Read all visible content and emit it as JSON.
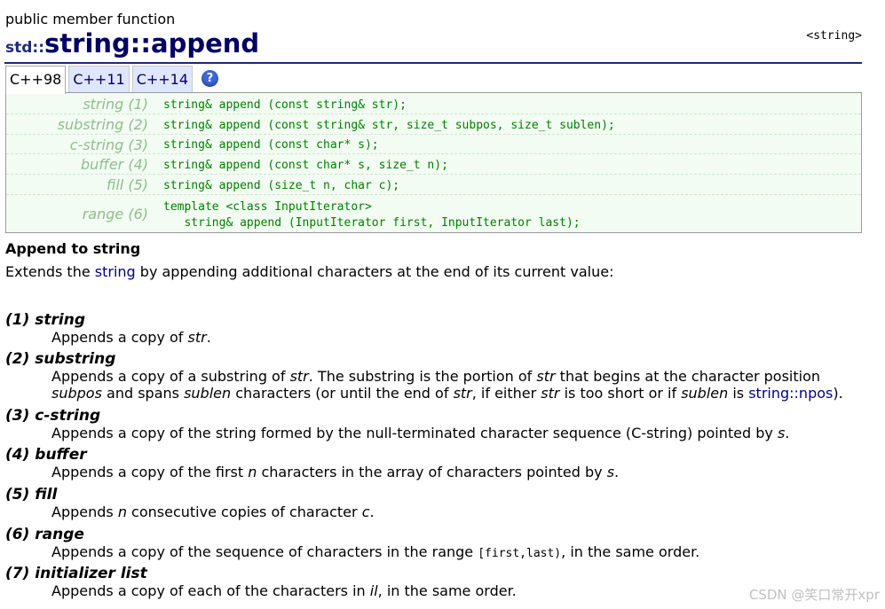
{
  "header": {
    "kind": "public member function",
    "namespace": "std::",
    "class_name": "string",
    "separator": "::",
    "function_name": "append",
    "header_link": "<string>"
  },
  "tabs": [
    {
      "label": "C++98",
      "active": true
    },
    {
      "label": "C++11",
      "active": false
    },
    {
      "label": "C++14",
      "active": false
    }
  ],
  "help_icon": {
    "name": "help-icon",
    "glyph": "?"
  },
  "prototypes": [
    {
      "label": "string (1)",
      "code": "string& append (const string& str);"
    },
    {
      "label": "substring (2)",
      "code": "string& append (const string& str, size_t subpos, size_t sublen);"
    },
    {
      "label": "c-string (3)",
      "code": "string& append (const char* s);"
    },
    {
      "label": "buffer (4)",
      "code": "string& append (const char* s, size_t n);"
    },
    {
      "label": "fill (5)",
      "code": "string& append (size_t n, char c);"
    },
    {
      "label": "range (6)",
      "code": "template <class InputIterator>\n   string& append (InputIterator first, InputIterator last);"
    }
  ],
  "summary": {
    "heading": "Append to string",
    "pre": "Extends the ",
    "link": "string",
    "post": " by appending additional characters at the end of its current value:"
  },
  "items": [
    {
      "head": "(1) string",
      "line1": [
        "Appends a copy of ",
        "str",
        "."
      ]
    },
    {
      "head": "(2) substring",
      "line1": [
        "Appends a copy of a substring of ",
        "str",
        ". The substring is the portion of ",
        "str",
        " that begins at the character position"
      ],
      "line2": [
        "subpos",
        " and spans ",
        "sublen",
        " characters (or until the end of ",
        "str",
        ", if either ",
        "str",
        " is too short or if ",
        "sublen",
        " is ",
        "string::npos",
        ")."
      ]
    },
    {
      "head": "(3) c-string",
      "line1": [
        "Appends a copy of the string formed by the null-terminated character sequence (C-string) pointed by ",
        "s",
        "."
      ]
    },
    {
      "head": "(4) buffer",
      "line1": [
        "Appends a copy of the first ",
        "n",
        " characters in the array of characters pointed by ",
        "s",
        "."
      ]
    },
    {
      "head": "(5) fill",
      "line1": [
        "Appends ",
        "n",
        " consecutive copies of character ",
        "c",
        "."
      ]
    },
    {
      "head": "(6) range",
      "line1": [
        "Appends a copy of the sequence of characters in the range ",
        "[first,last)",
        ", in the same order."
      ]
    },
    {
      "head": "(7) initializer list",
      "line1": [
        "Appends a copy of each of the characters in ",
        "il",
        ", in the same order."
      ]
    }
  ],
  "watermark": "CSDN @笑口常开xpr",
  "colors": {
    "title": "#000066",
    "code": "#008000",
    "link": "#000088",
    "proto_bg": "#f2fcf2"
  }
}
